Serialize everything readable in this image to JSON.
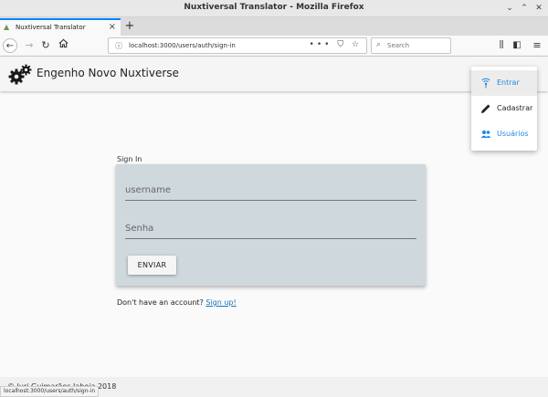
{
  "window": {
    "title": "Nuxtiversal Translator - Mozilla Firefox",
    "controls": [
      "⌄",
      "⌃",
      "✕"
    ]
  },
  "tab": {
    "label": "Nuxtiversal Translator",
    "close": "×",
    "new_tab": "+"
  },
  "nav": {
    "url": "localhost:3000/users/auth/sign-in",
    "actions": "•••",
    "search_placeholder": "Search"
  },
  "app": {
    "brand": "Engenho Novo Nuxtiverse"
  },
  "menu": {
    "items": [
      {
        "label": "Entrar",
        "color": "#1e88e5",
        "icon": "wifi-signal-icon"
      },
      {
        "label": "Cadastrar",
        "color": "#222222",
        "icon": "pencil-icon"
      },
      {
        "label": "Usuários",
        "color": "#1e88e5",
        "icon": "people-icon"
      }
    ]
  },
  "signin": {
    "heading": "Sign In",
    "username_placeholder": "username",
    "password_placeholder": "Senha",
    "submit_label": "ENVIAR",
    "no_account_text": "Don't have an account?",
    "signup_link": "Sign up!"
  },
  "footer": {
    "copyright": "© Iuri Guimarães Jaboja 2018"
  },
  "status": {
    "url": "localhost:3000/users/auth/sign-in"
  },
  "colors": {
    "accent": "#0a84ff",
    "card": "#cfd8dc",
    "link": "#1a73b8"
  }
}
